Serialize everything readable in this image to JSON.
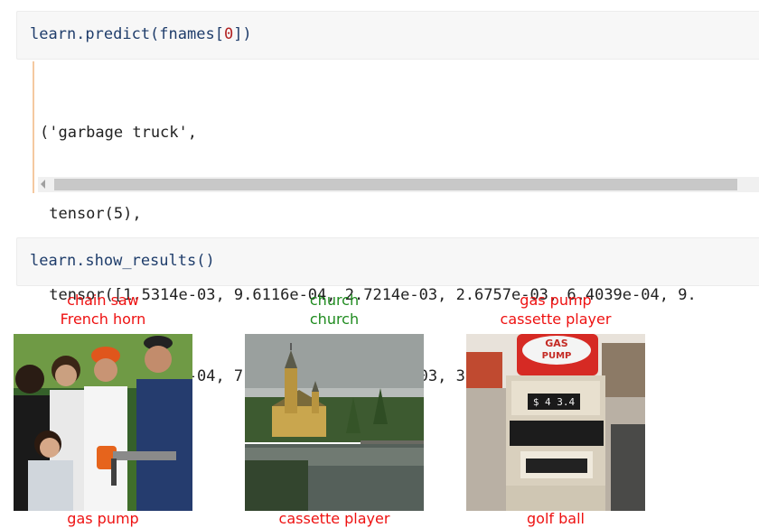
{
  "cell1": {
    "code_prefix": "learn.predict(fnames[",
    "code_index": "0",
    "code_suffix": "])"
  },
  "output1": {
    "lines": [
      "('garbage truck',",
      " tensor(5),",
      " tensor([1.5314e-03, 9.6116e-04, 2.7214e-03, 2.6757e-03, 6.4039e-04, 9.",
      "         8.1883e-04, 7.5840e-04, 1.0780e-03, 3.9759e-04]))"
    ]
  },
  "cell2": {
    "code": "learn.show_results()"
  },
  "results": [
    {
      "actual": "chain saw",
      "predicted": "French horn",
      "color": "#ee1111"
    },
    {
      "actual": "church",
      "predicted": "church",
      "color": "#1f8b1f"
    },
    {
      "actual": "gas pump",
      "predicted": "cassette player",
      "color": "#ee1111"
    }
  ],
  "bottom_labels": [
    "gas pump",
    "cassette player",
    "golf ball"
  ],
  "sign_text": {
    "line1": "GAS",
    "line2": "PUMP",
    "display": "$ 4 3.4"
  }
}
